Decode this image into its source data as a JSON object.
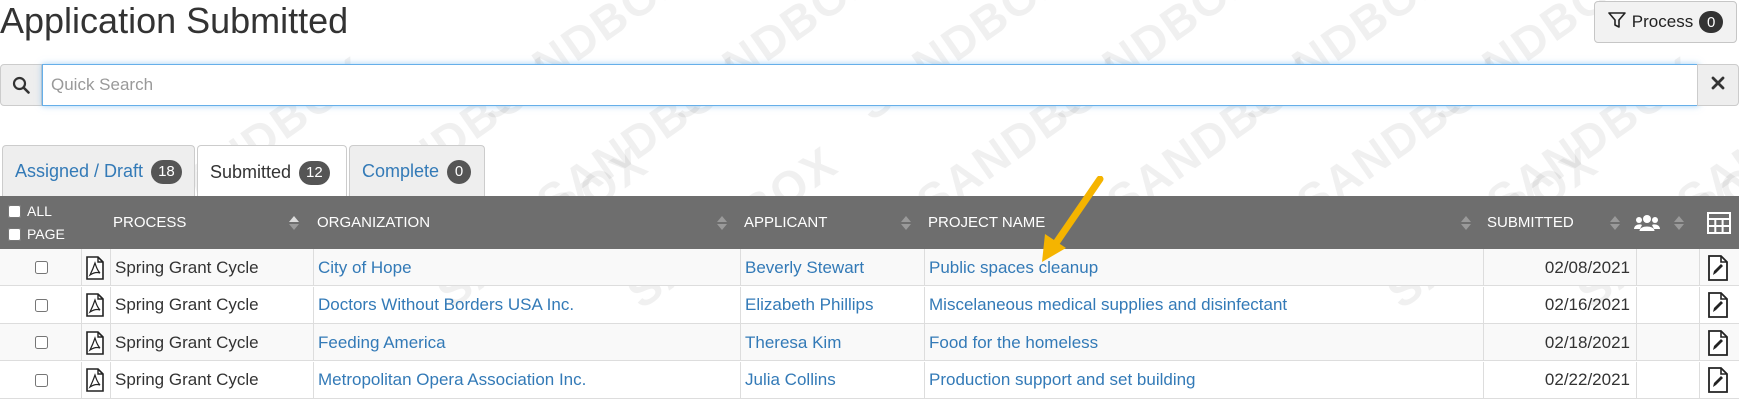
{
  "page": {
    "title": "Application Submitted",
    "watermark": "SANDBOX"
  },
  "process_button": {
    "label": "Process",
    "count": "0",
    "icon": "filter-icon"
  },
  "search": {
    "placeholder": "Quick Search",
    "value": "",
    "icon": "search-icon",
    "clear_icon": "close-icon"
  },
  "tabs": [
    {
      "label": "Assigned / Draft",
      "count": "18",
      "active": false
    },
    {
      "label": "Submitted",
      "count": "12",
      "active": true
    },
    {
      "label": "Complete",
      "count": "0",
      "active": false
    }
  ],
  "table": {
    "select_all_label": "ALL",
    "select_page_label": "PAGE",
    "columns": {
      "process": "PROCESS",
      "organization": "ORGANIZATION",
      "applicant": "APPLICANT",
      "project_name": "PROJECT NAME",
      "submitted": "SUBMITTED"
    },
    "rows": [
      {
        "process": "Spring Grant Cycle",
        "organization": "City of Hope",
        "applicant": "Beverly Stewart",
        "project_name": "Public spaces cleanup",
        "submitted": "02/08/2021"
      },
      {
        "process": "Spring Grant Cycle",
        "organization": "Doctors Without Borders USA Inc.",
        "applicant": "Elizabeth Phillips",
        "project_name": "Miscelaneous medical supplies and disinfectant",
        "submitted": "02/16/2021"
      },
      {
        "process": "Spring Grant Cycle",
        "organization": "Feeding America",
        "applicant": "Theresa Kim",
        "project_name": "Food for the homeless",
        "submitted": "02/18/2021"
      },
      {
        "process": "Spring Grant Cycle",
        "organization": "Metropolitan Opera Association Inc.",
        "applicant": "Julia Collins",
        "project_name": "Production support and set building",
        "submitted": "02/22/2021"
      }
    ]
  },
  "colors": {
    "header_bg": "#6e6e6e",
    "link": "#337ab7",
    "arrow": "#f5b400",
    "badge": "#555555"
  }
}
